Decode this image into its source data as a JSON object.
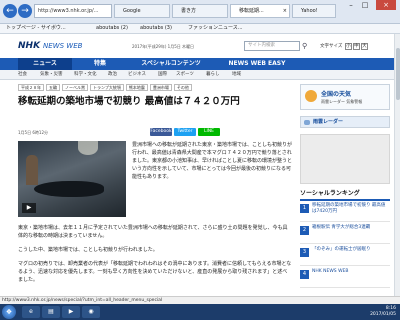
{
  "browser": {
    "address_text": "http://www3.nhk.or.jp/...",
    "back_icon": "arrow-left-icon",
    "forward_icon": "arrow-right-icon",
    "tabs": [
      {
        "label": "Google"
      },
      {
        "label": "書き方"
      },
      {
        "label": "移転延期...",
        "active": true
      },
      {
        "label": "Yahoo!"
      }
    ],
    "favorites": [
      "トップページ - サイボウ...",
      "aboutabs (2)",
      "aboutabs (3)",
      "ファッションニュース..."
    ]
  },
  "site": {
    "logo": "NHK",
    "logo_sub": "NEWS WEB",
    "date": "2017年(平成29年) 1月5日 木曜日",
    "search_placeholder": "サイト内検索",
    "search_icon": "search-icon",
    "font_size_label": "文字サイズ",
    "font_sizes": [
      "小",
      "中",
      "大"
    ],
    "main_nav": [
      {
        "label": "ニュース",
        "highlight": true
      },
      {
        "label": "特集"
      },
      {
        "label": "スペシャルコンテンツ"
      },
      {
        "label": "NEWS WEB EASY"
      }
    ],
    "sub_nav": [
      "社会",
      "気象・災害",
      "科学・文化",
      "政治",
      "ビジネス",
      "国際",
      "スポーツ",
      "暮らし",
      "地域"
    ],
    "current_sub": "社会"
  },
  "article": {
    "tags": [
      "平成２８年",
      "五輪",
      "ノーベル賞",
      "トランプ大統領",
      "熊本地震",
      "豊洲市場",
      "その他"
    ],
    "title": "移転延期の築地市場で初競り 最高値は７４２０万円",
    "date": "1月5日 6時12分",
    "share_buttons": [
      "Facebook",
      "Twitter",
      "LINE"
    ],
    "photo_caption_icon": "play-icon",
    "para1": "豊洲市場への移転が延期された東京・築地市場では、ことしも初競りが行われ、最高値は青森県大間産で本マグロ７４２０万円で競り落とされました。東京都の小池知事は、早ければことし夏に移転の環境が整うという方向性を示していて、市場にとっては今回が最後の初競りになる可能性もあります。",
    "para2": "東京・築地市場は、去年１１月に予定されていた豊洲市場への移転が延期されて、さらに盛り土の問題を発覚し、今も具体的な移転の時期は決まっていません。",
    "para3": "こうした中、築地市場では、ことしも初競りが行われました。",
    "para4": "マグロの初売りでは、卸売業者の代表が「移転延期でわれわれはその渦中にあります。消費者に信頼してもらえる市場となるよう、迅速な対応を優先します。一刻も早く方向性を決めていただけないと、産直の発展から取り残されます」と述べました。"
  },
  "sidebar": {
    "weather_title": "全国の天気",
    "weather_sub": "雨雲レーダー 気象警報",
    "weather_icon": "sun-icon",
    "rain_label": "雨雲レーダー",
    "ranking_title": "ソーシャルランキング",
    "ranking": [
      {
        "num": "1",
        "text": "移転延期の築地市場で初競り 最高値は7420万円"
      },
      {
        "num": "2",
        "text": "箱根駅伝 青学大が総合3連覇"
      },
      {
        "num": "3",
        "text": "「のぞみ」の運転士が居眠り"
      },
      {
        "num": "4",
        "text": "NHK NEWS WEB"
      }
    ]
  },
  "status_bar": "http://www3.nhk.or.jp/news/special/?utm_int=all_header_menu_special",
  "taskbar": {
    "time": "8:16",
    "date": "2017/01/05"
  }
}
